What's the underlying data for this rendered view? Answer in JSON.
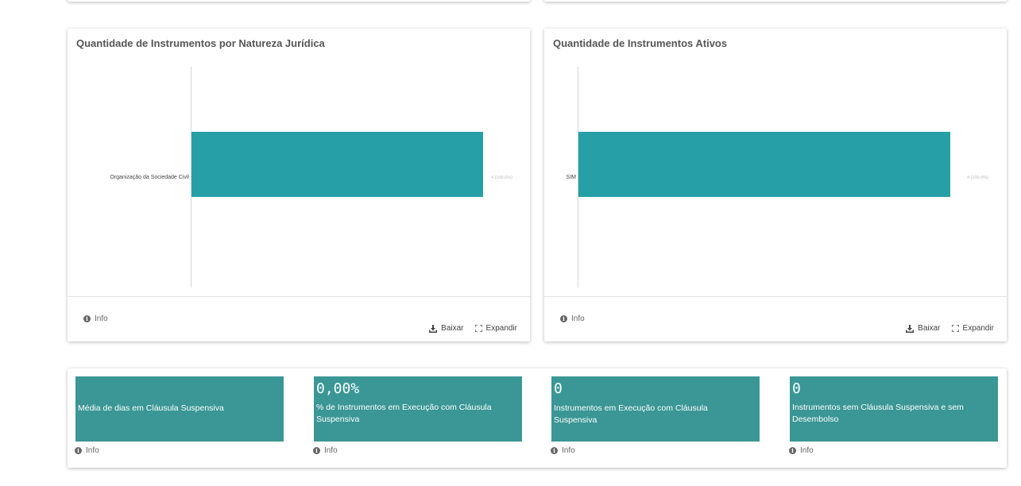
{
  "charts": [
    {
      "title": "Quantidade de Instrumentos por Natureza Jurídica",
      "info_label": "Info",
      "download_label": "Baixar",
      "expand_label": "Expandir",
      "chart_data": {
        "type": "bar",
        "orientation": "horizontal",
        "categories": [
          "Organização da Sociedade Civil"
        ],
        "values": [
          4
        ],
        "value_labels": [
          "4 (100,0%)"
        ],
        "bar_color": "#26a0a6",
        "grid": false
      }
    },
    {
      "title": "Quantidade de Instrumentos Ativos",
      "info_label": "Info",
      "download_label": "Baixar",
      "expand_label": "Expandir",
      "chart_data": {
        "type": "bar",
        "orientation": "horizontal",
        "categories": [
          "SIM"
        ],
        "values": [
          4
        ],
        "value_labels": [
          "4 (100,0%)"
        ],
        "bar_color": "#26a0a6",
        "grid": false
      }
    }
  ],
  "kpis": [
    {
      "value": "",
      "label": "Média de dias em Cláusula Suspensiva",
      "info_label": "Info"
    },
    {
      "value": "0,00%",
      "label": "% de Instrumentos em Execução com Cláusula Suspensiva",
      "info_label": "Info"
    },
    {
      "value": "0",
      "label": "Instrumentos em Execução com Cláusula Suspensiva",
      "info_label": "Info"
    },
    {
      "value": "0",
      "label": "Instrumentos sem Cláusula Suspensiva e sem Desembolso",
      "info_label": "Info"
    }
  ],
  "colors": {
    "kpi_background": "#3b9696",
    "bar": "#26a0a6"
  },
  "icons": {
    "info": "info-icon",
    "download": "download-icon",
    "expand": "expand-icon"
  }
}
